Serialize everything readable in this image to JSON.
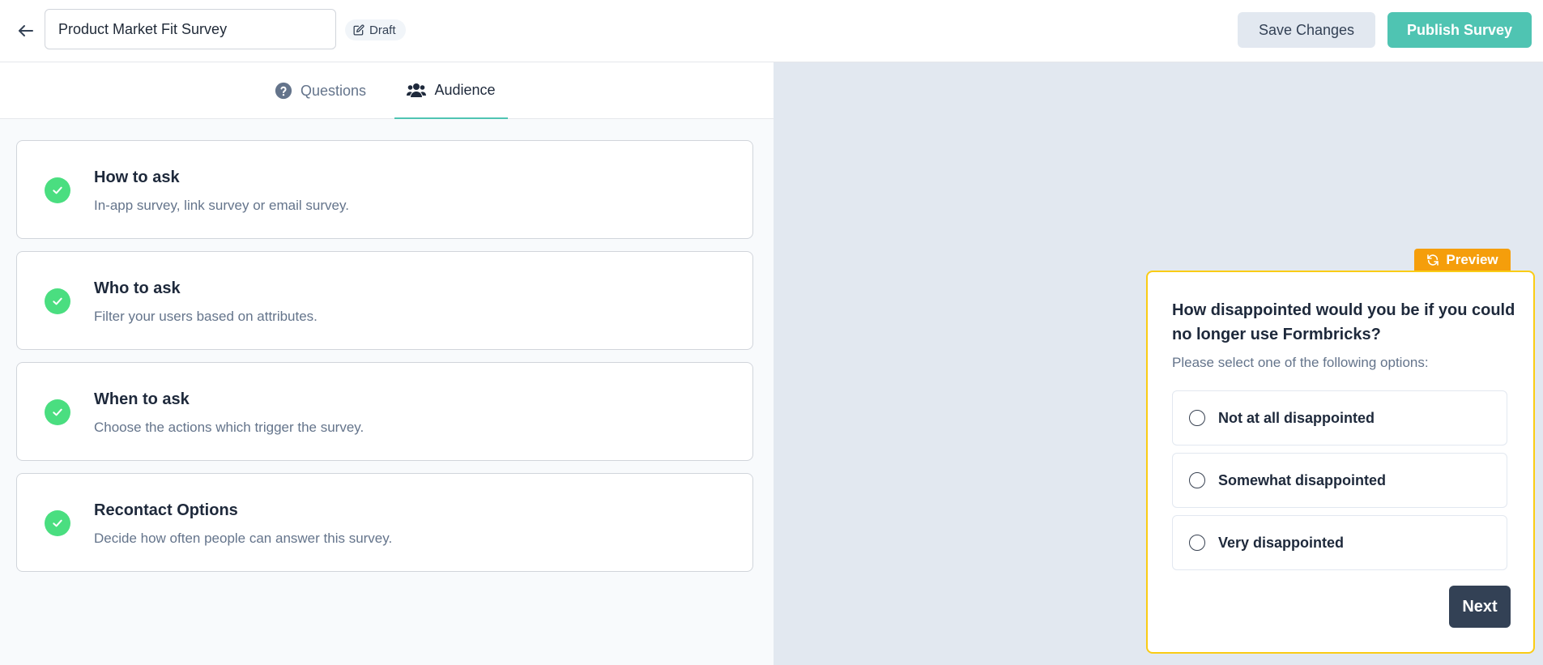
{
  "header": {
    "survey_title": "Product Market Fit Survey",
    "status_label": "Draft",
    "save_label": "Save Changes",
    "publish_label": "Publish Survey"
  },
  "tabs": [
    {
      "label": "Questions",
      "active": false,
      "icon": "question-circle-icon"
    },
    {
      "label": "Audience",
      "active": true,
      "icon": "users-icon"
    }
  ],
  "audience_cards": [
    {
      "title": "How to ask",
      "description": "In-app survey, link survey or email survey."
    },
    {
      "title": "Who to ask",
      "description": "Filter your users based on attributes."
    },
    {
      "title": "When to ask",
      "description": "Choose the actions which trigger the survey."
    },
    {
      "title": "Recontact Options",
      "description": "Decide how often people can answer this survey."
    }
  ],
  "preview": {
    "tag_label": "Preview",
    "headline": "How disappointed would you be if you could no longer use Formbricks?",
    "subheader": "Please select one of the following options:",
    "options": [
      "Not at all disappointed",
      "Somewhat disappointed",
      "Very disappointed"
    ],
    "next_label": "Next"
  },
  "colors": {
    "brand": "#4fc4b2",
    "check": "#4ade80",
    "preview_tag": "#f59e0b",
    "preview_border": "#facc15",
    "next_button": "#334155"
  }
}
